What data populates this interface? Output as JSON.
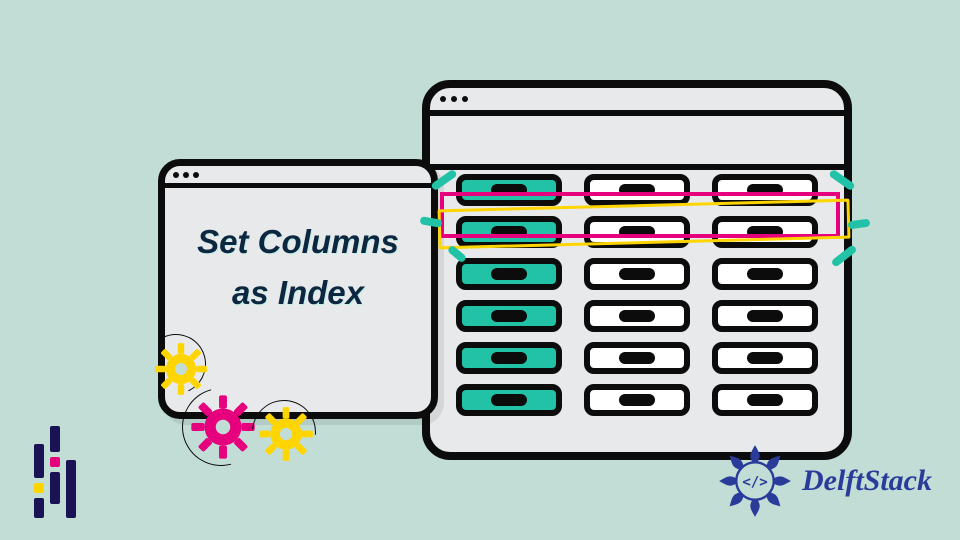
{
  "hero": {
    "line1": "Set Columns",
    "line2": "as Index"
  },
  "brand": {
    "name": "DelftStack"
  },
  "colors": {
    "background": "#c2ddd6",
    "outline": "#0c0c0c",
    "teal": "#21c2a5",
    "magenta": "#e6007e",
    "yellow": "#ffd500",
    "navy": "#1a1255",
    "brandBlue": "#2a3b9a"
  },
  "icons": {
    "gear_yellow_top": "gear-icon",
    "gear_magenta": "gear-icon",
    "gear_yellow_right": "gear-icon",
    "pandas_mark": "bars-logo-icon",
    "delft_mandala": "mandala-code-icon"
  },
  "spreadsheet": {
    "rows": 6,
    "cols": 3,
    "index_column": 0
  }
}
